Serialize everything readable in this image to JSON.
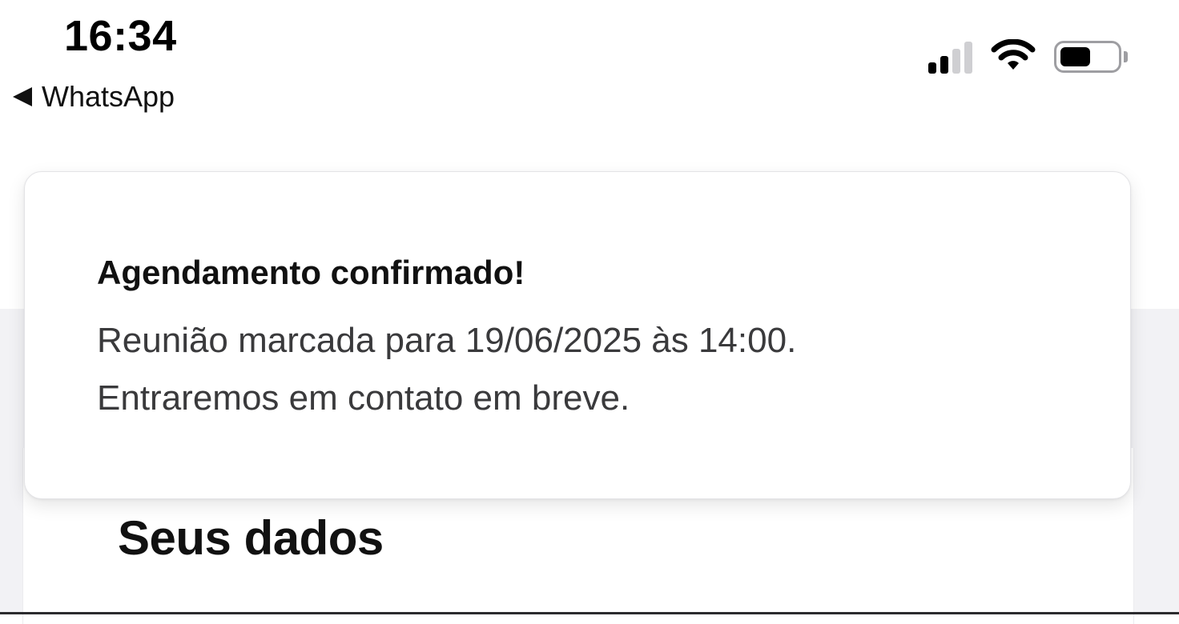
{
  "status_bar": {
    "time": "16:34",
    "back_label": "WhatsApp",
    "signal_level": "2/4",
    "battery_level": 0.55,
    "icons": [
      "signal-icon",
      "wifi-icon",
      "battery-icon",
      "back-arrow-icon"
    ]
  },
  "toast": {
    "title": "Agendamento confirmado!",
    "line1": "Reunião marcada para 19/06/2025 às 14:00.",
    "line2": "Entraremos em contato em breve."
  },
  "content": {
    "section_title": "Seus dados"
  },
  "colors": {
    "page_background": "#f2f2f5",
    "card_background": "#ffffff",
    "text_primary": "#111111",
    "text_secondary": "#3a3a3c"
  }
}
